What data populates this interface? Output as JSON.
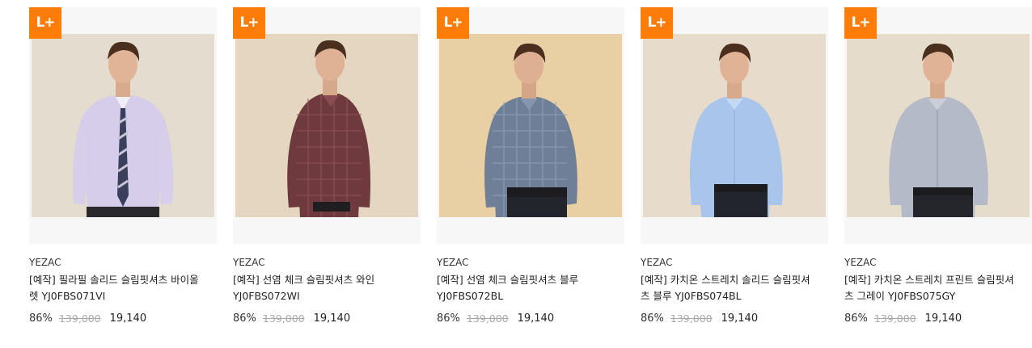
{
  "badge_label": "L+",
  "products": [
    {
      "brand": "YEZAC",
      "name": "[예작] 필라필 솔리드 슬림핏셔츠 바이올렛 YJ0FBS071VI",
      "discount": "86%",
      "original_price": "139,000",
      "sale_price": "19,140",
      "shirt_color": "#d6cdea",
      "background_color": "#e5dcd0"
    },
    {
      "brand": "YEZAC",
      "name": "[예작] 선염 체크 슬림핏셔츠 와인 YJ0FBS072WI",
      "discount": "86%",
      "original_price": "139,000",
      "sale_price": "19,140",
      "shirt_color": "#6e3a3e",
      "background_color": "#e4d6c0"
    },
    {
      "brand": "YEZAC",
      "name": "[예작] 선염 체크 슬림핏셔츠 블루 YJ0FBS072BL",
      "discount": "86%",
      "original_price": "139,000",
      "sale_price": "19,140",
      "shirt_color": "#6f7f98",
      "background_color": "#e8cfa4"
    },
    {
      "brand": "YEZAC",
      "name": "[예작] 카치온 스트레치 솔리드 슬림핏셔츠 블루 YJ0FBS074BL",
      "discount": "86%",
      "original_price": "139,000",
      "sale_price": "19,140",
      "shirt_color": "#a9c5ec",
      "background_color": "#e7dccb"
    },
    {
      "brand": "YEZAC",
      "name": "[예작] 카치온 스트레치 프린트 슬림핏셔츠 그레이 YJ0FBS075GY",
      "discount": "86%",
      "original_price": "139,000",
      "sale_price": "19,140",
      "shirt_color": "#b4bac7",
      "background_color": "#e6dccc"
    }
  ]
}
